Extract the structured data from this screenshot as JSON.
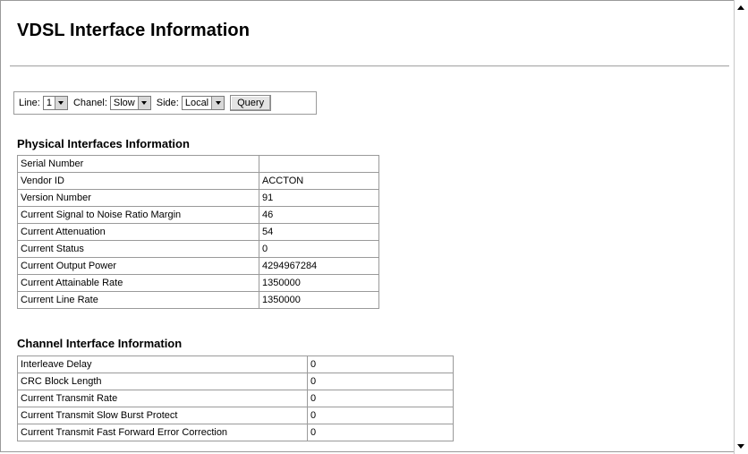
{
  "page_title": "VDSL Interface Information",
  "query": {
    "line_label": "Line:",
    "line_value": "1",
    "channel_label": "Chanel:",
    "channel_value": "Slow",
    "side_label": "Side:",
    "side_value": "Local",
    "query_button": "Query"
  },
  "physical": {
    "heading": "Physical Interfaces Information",
    "rows": [
      {
        "label": "Serial Number",
        "value": ""
      },
      {
        "label": "Vendor ID",
        "value": "ACCTON"
      },
      {
        "label": "Version Number",
        "value": "91"
      },
      {
        "label": "Current Signal to Noise Ratio Margin",
        "value": "46"
      },
      {
        "label": "Current Attenuation",
        "value": "54"
      },
      {
        "label": "Current Status",
        "value": "0"
      },
      {
        "label": "Current Output Power",
        "value": "4294967284"
      },
      {
        "label": "Current Attainable Rate",
        "value": "1350000"
      },
      {
        "label": "Current Line Rate",
        "value": "1350000"
      }
    ]
  },
  "channel": {
    "heading": "Channel Interface Information",
    "rows": [
      {
        "label": "Interleave Delay",
        "value": "0"
      },
      {
        "label": "CRC Block Length",
        "value": "0"
      },
      {
        "label": "Current Transmit Rate",
        "value": "0"
      },
      {
        "label": "Current Transmit Slow Burst Protect",
        "value": "0"
      },
      {
        "label": "Current Transmit Fast Forward Error Correction",
        "value": "0"
      }
    ]
  }
}
